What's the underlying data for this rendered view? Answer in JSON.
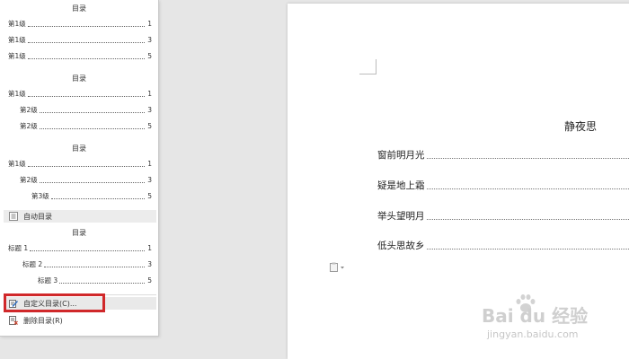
{
  "toc_panel": {
    "styles": [
      {
        "title": "目录",
        "entries": [
          {
            "label": "第1级",
            "page": "1"
          },
          {
            "label": "第1级",
            "page": "3"
          },
          {
            "label": "第1级",
            "page": "5"
          }
        ]
      },
      {
        "title": "目录",
        "entries": [
          {
            "label": "第1级",
            "page": "1"
          },
          {
            "label": "第2级",
            "page": "3"
          },
          {
            "label": "第2级",
            "page": "5"
          }
        ]
      },
      {
        "title": "目录",
        "entries": [
          {
            "label": "第1级",
            "page": "1"
          },
          {
            "label": "第2级",
            "page": "3"
          },
          {
            "label": "第3级",
            "page": "5"
          }
        ]
      }
    ],
    "auto_toc_label": "自动目录",
    "auto_toc": {
      "title": "目录",
      "entries": [
        {
          "label": "标题 1",
          "page": "1"
        },
        {
          "label": "标题 2",
          "page": "3"
        },
        {
          "label": "标题 3",
          "page": "5"
        }
      ]
    },
    "custom_toc_label": "自定义目录(C)...",
    "delete_toc_label": "删除目录(R)"
  },
  "document": {
    "title": "静夜思",
    "entries": [
      "窗前明月光",
      "疑是地上霜",
      "举头望明月",
      "低头思故乡"
    ]
  },
  "watermark": {
    "main": "Bai du 经验",
    "sub": "jingyan.baidu.com"
  },
  "colors": {
    "highlight_border": "#d0282a",
    "canvas_bg": "#e6e6e6"
  }
}
